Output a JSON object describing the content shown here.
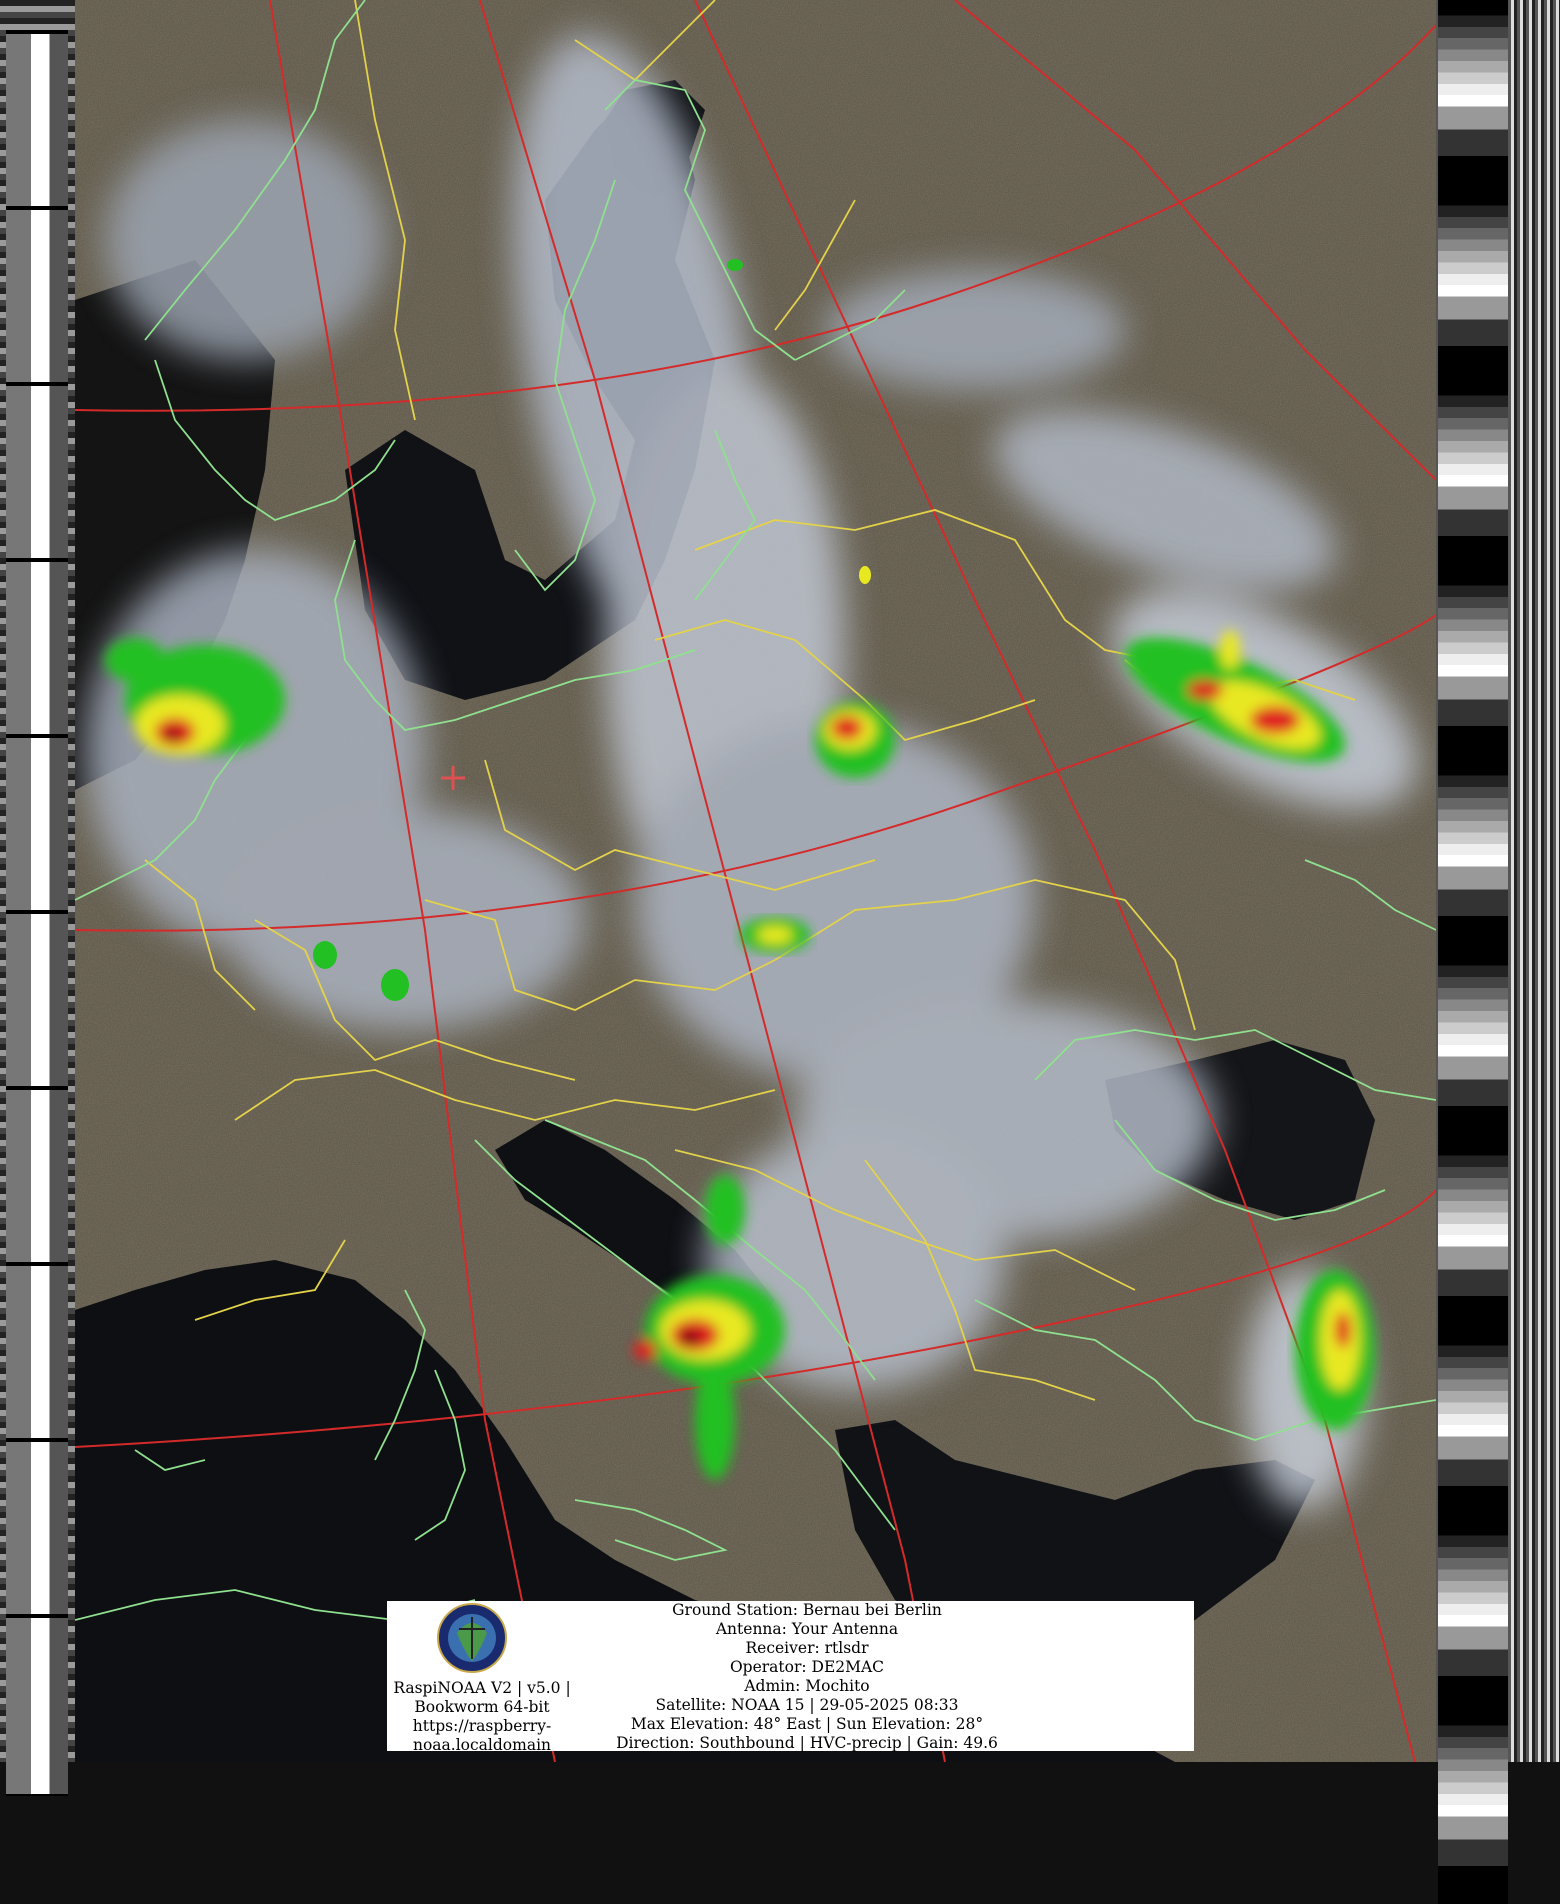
{
  "station_info": {
    "lines": [
      "RaspiNOAA V2 | v5.0 |",
      "Bookworm 64-bit",
      "https://raspberry-",
      "noaa.localdomain"
    ]
  },
  "pass_info": {
    "ground_station": "Ground Station: Bernau bei Berlin",
    "antenna": "Antenna: Your Antenna",
    "receiver": "Receiver: rtlsdr",
    "operator": "Operator: DE2MAC",
    "admin": "Admin: Mochito",
    "satellite": "Satellite: NOAA 15 | 29-05-2025 08:33",
    "elevation": "Max Elevation: 48° East | Sun Elevation: 28°",
    "direction": "Direction: Southbound | HVC-precip | Gain: 49.6"
  },
  "logo_icon": "raspinoaa-logo-icon",
  "map_overlay": {
    "coastline_color": "#8fe08f",
    "border_color": "#e3d24a",
    "graticule_color": "#d42a2a",
    "marker_color": "#e05050",
    "land_color": "#5c5443",
    "sea_color": "#0d0f12",
    "cloud_color": "#b9c0cc",
    "precip_colors": [
      "#22c022",
      "#e8e820",
      "#e02020",
      "#7a0a0a"
    ]
  }
}
